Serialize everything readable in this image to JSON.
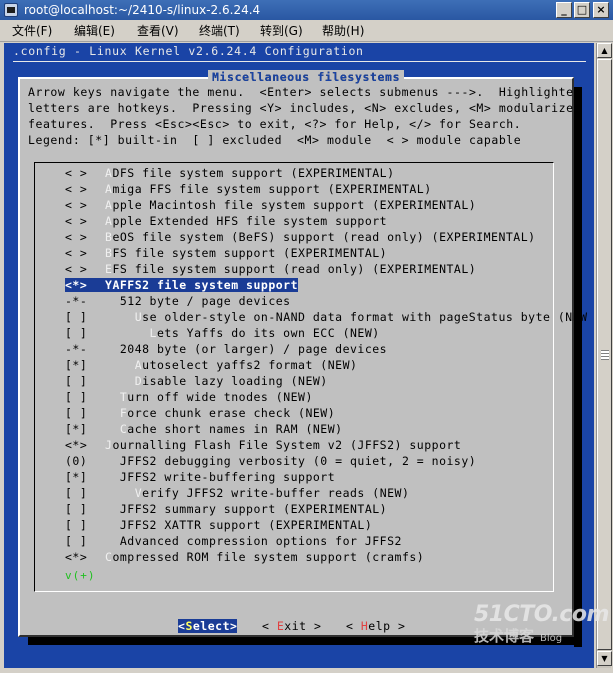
{
  "window": {
    "title": "root@localhost:~/2410-s/linux-2.6.24.4",
    "minimize": "_",
    "maximize": "□",
    "close": "×"
  },
  "menubar": [
    {
      "name": "file",
      "label": "文件(F)"
    },
    {
      "name": "edit",
      "label": "编辑(E)"
    },
    {
      "name": "view",
      "label": "查看(V)"
    },
    {
      "name": "terminal",
      "label": "终端(T)"
    },
    {
      "name": "goto",
      "label": "转到(G)"
    },
    {
      "name": "help",
      "label": "帮助(H)"
    }
  ],
  "config": {
    "header": ".config - Linux Kernel v2.6.24.4 Configuration",
    "dialog_title": "Miscellaneous filesystems",
    "help_lines": [
      "Arrow keys navigate the menu.  <Enter> selects submenus --->.  Highlighted",
      "letters are hotkeys.  Pressing <Y> includes, <N> excludes, <M> modularizes",
      "features.  Press <Esc><Esc> to exit, <?> for Help, </> for Search.",
      "Legend: [*] built-in  [ ] excluded  <M> module  < > module capable"
    ],
    "items": [
      {
        "mark": "< >",
        "indent": "",
        "hot": "A",
        "rest": "DFS file system support (EXPERIMENTAL)"
      },
      {
        "mark": "< >",
        "indent": "",
        "hot": "A",
        "rest": "miga FFS file system support (EXPERIMENTAL)"
      },
      {
        "mark": "< >",
        "indent": "",
        "hot": "A",
        "rest": "pple Macintosh file system support (EXPERIMENTAL)"
      },
      {
        "mark": "< >",
        "indent": "",
        "hot": "A",
        "rest": "pple Extended HFS file system support"
      },
      {
        "mark": "< >",
        "indent": "",
        "hot": "B",
        "rest": "eOS file system (BeFS) support (read only) (EXPERIMENTAL)"
      },
      {
        "mark": "< >",
        "indent": "",
        "hot": "B",
        "rest": "FS file system support (EXPERIMENTAL)"
      },
      {
        "mark": "< >",
        "indent": "",
        "hot": "E",
        "rest": "FS file system support (read only) (EXPERIMENTAL)"
      },
      {
        "mark": "<*>",
        "indent": "",
        "hot": "Y",
        "rest": "AFFS2 file system support",
        "selected": true
      },
      {
        "mark": "-*-",
        "indent": "  ",
        "hot": "",
        "rest": "512 byte / page devices"
      },
      {
        "mark": "[ ]",
        "indent": "    ",
        "hot": "U",
        "rest": "se older-style on-NAND data format with pageStatus byte (NEW"
      },
      {
        "mark": "[ ]",
        "indent": "      ",
        "hot": "L",
        "rest": "ets Yaffs do its own ECC (NEW)"
      },
      {
        "mark": "-*-",
        "indent": "  ",
        "hot": "",
        "rest": "2048 byte (or larger) / page devices"
      },
      {
        "mark": "[*]",
        "indent": "    ",
        "hot": "A",
        "rest": "utoselect yaffs2 format (NEW)"
      },
      {
        "mark": "[ ]",
        "indent": "    ",
        "hot": "D",
        "rest": "isable lazy loading (NEW)"
      },
      {
        "mark": "[ ]",
        "indent": "  ",
        "hot": "T",
        "rest": "urn off wide tnodes (NEW)"
      },
      {
        "mark": "[ ]",
        "indent": "  ",
        "hot": "F",
        "rest": "orce chunk erase check (NEW)"
      },
      {
        "mark": "[*]",
        "indent": "  ",
        "hot": "C",
        "rest": "ache short names in RAM (NEW)"
      },
      {
        "mark": "<*>",
        "indent": "",
        "hot": "J",
        "rest": "ournalling Flash File System v2 (JFFS2) support"
      },
      {
        "mark": "(0)",
        "indent": "  ",
        "hot": "",
        "rest": "JFFS2 debugging verbosity (0 = quiet, 2 = noisy)"
      },
      {
        "mark": "[*]",
        "indent": "  ",
        "hot": "",
        "rest": "JFFS2 write-buffering support"
      },
      {
        "mark": "[ ]",
        "indent": "    ",
        "hot": "V",
        "rest": "erify JFFS2 write-buffer reads (NEW)"
      },
      {
        "mark": "[ ]",
        "indent": "  ",
        "hot": "",
        "rest": "JFFS2 summary support (EXPERIMENTAL)"
      },
      {
        "mark": "[ ]",
        "indent": "  ",
        "hot": "",
        "rest": "JFFS2 XATTR support (EXPERIMENTAL)"
      },
      {
        "mark": "[ ]",
        "indent": "  ",
        "hot": "",
        "rest": "Advanced compression options for JFFS2"
      },
      {
        "mark": "<*>",
        "indent": "",
        "hot": "C",
        "rest": "ompressed ROM file system support (cramfs)"
      }
    ],
    "more": "v(+)",
    "buttons": {
      "select": {
        "open": "<",
        "hot": "S",
        "rest": "elect",
        "close": ">"
      },
      "exit": {
        "open": "< ",
        "hot": "E",
        "rest": "xit",
        "close": " >"
      },
      "help": {
        "open": "< ",
        "hot": "H",
        "rest": "elp",
        "close": " >"
      }
    }
  },
  "watermark": {
    "top": "51CTO.com",
    "bottom": "技术博客",
    "blog": "Blog"
  },
  "colors": {
    "terminal_bg": "#1a44a6",
    "dialog_bg": "#c0c0c0",
    "selection": "#1a3c96",
    "hotkey_button": "#e04040"
  }
}
